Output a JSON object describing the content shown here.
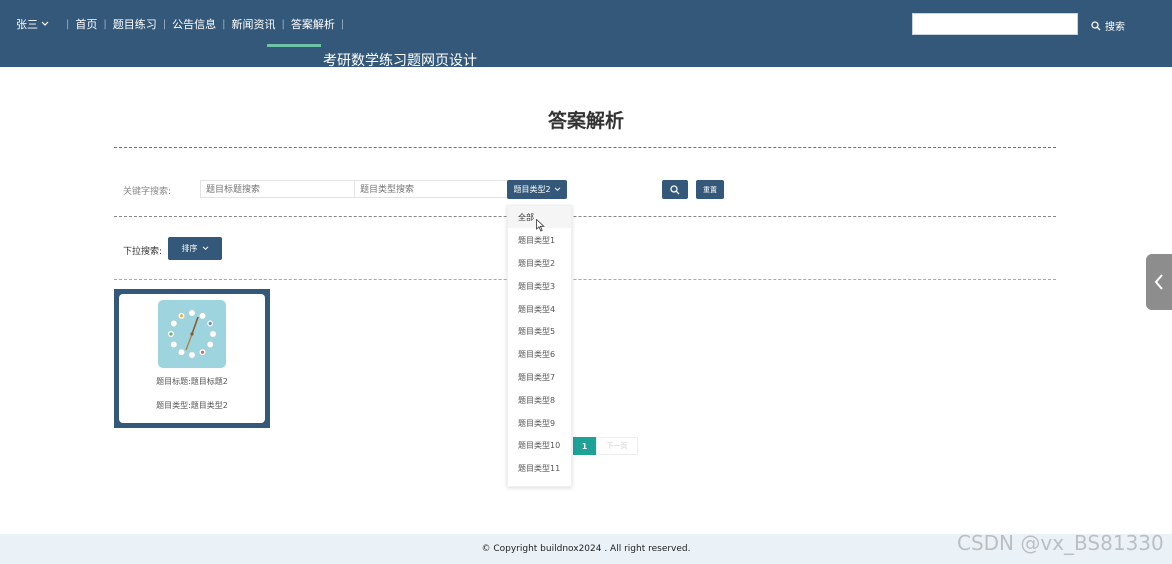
{
  "header": {
    "user": "张三",
    "nav": [
      "首页",
      "题目练习",
      "公告信息",
      "新闻资讯",
      "答案解析"
    ],
    "site_title": "考研数学练习题网页设计",
    "search_placeholder": "",
    "search_label": "搜索"
  },
  "main": {
    "title": "答案解析",
    "filter": {
      "keyword_label": "关键字搜索:",
      "title_placeholder": "题目标题搜索",
      "type_placeholder": "题目类型搜索",
      "type_select_label": "题目类型2",
      "reset_label": "重置"
    },
    "dropdown_label": "下拉搜索:",
    "sort_label": "排序",
    "type_options": [
      "全部",
      "题目类型1",
      "题目类型2",
      "题目类型3",
      "题目类型4",
      "题目类型5",
      "题目类型6",
      "题目类型7",
      "题目类型8",
      "题目类型9",
      "题目类型10",
      "题目类型11"
    ],
    "cards": [
      {
        "title": "题目标题:题目标题2",
        "type": "题目类型:题目类型2"
      }
    ],
    "pagination": {
      "current": "1",
      "next": "下一页"
    }
  },
  "footer": {
    "copyright": "© Copyright buildnox2024 . All right reserved."
  },
  "watermark": "CSDN @vx_BS81330",
  "colors": {
    "primary": "#34587a",
    "accent": "#1ea196",
    "underline": "#6fc3a6"
  }
}
